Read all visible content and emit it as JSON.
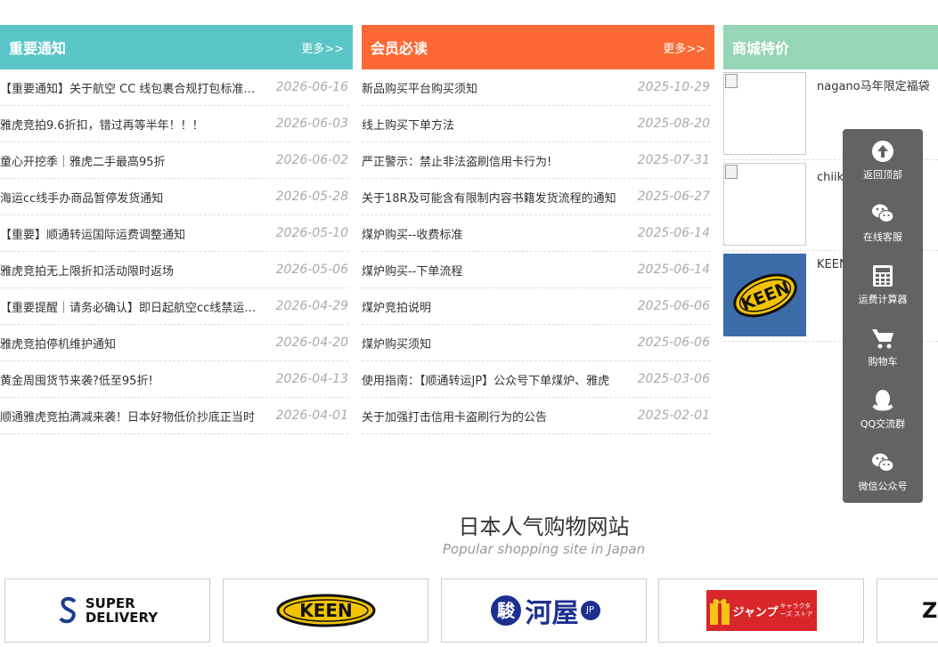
{
  "notice": {
    "title": "重要通知",
    "more": "更多>>",
    "items": [
      {
        "text": "【重要通知】关于航空 CC 线包裹合规打包标准通知",
        "date": "2026-06-16"
      },
      {
        "text": "雅虎竞拍9.6折扣，错过再等半年！！！",
        "date": "2026-06-03"
      },
      {
        "text": "童心开挖季｜雅虎二手最高95折",
        "date": "2026-06-02"
      },
      {
        "text": "海运cc线手办商品暂停发货通知",
        "date": "2026-05-28"
      },
      {
        "text": "【重要】顺通转运国际运费调整通知",
        "date": "2026-05-10"
      },
      {
        "text": "雅虎竞拍无上限折扣活动限时返场",
        "date": "2026-05-06"
      },
      {
        "text": "【重要提醒｜请务必确认】即日起航空cc线禁运商品通知",
        "date": "2026-04-29"
      },
      {
        "text": "雅虎竞拍停机维护通知",
        "date": "2026-04-20"
      },
      {
        "text": "黄金周囤货节来袭?低至95折!",
        "date": "2026-04-13"
      },
      {
        "text": "顺通雅虎竞拍满减来袭！日本好物低价抄底正当时",
        "date": "2026-04-01"
      }
    ]
  },
  "member": {
    "title": "会员必读",
    "more": "更多>>",
    "items": [
      {
        "text": "新品购买平台购买须知",
        "date": "2025-10-29"
      },
      {
        "text": "线上购买下单方法",
        "date": "2025-08-20"
      },
      {
        "text": "严正警示：禁止非法盗刷信用卡行为!",
        "date": "2025-07-31"
      },
      {
        "text": "关于18R及可能含有限制内容书籍发货流程的通知",
        "date": "2025-06-27"
      },
      {
        "text": "煤炉购买--收费标准",
        "date": "2025-06-14"
      },
      {
        "text": "煤炉购买--下单流程",
        "date": "2025-06-14"
      },
      {
        "text": "煤炉竞拍说明",
        "date": "2025-06-06"
      },
      {
        "text": "煤炉购买须知",
        "date": "2025-06-06"
      },
      {
        "text": "使用指南：【顺通转运JP】公众号下单煤炉、雅虎",
        "date": "2025-03-06"
      },
      {
        "text": "关于加强打击信用卡盗刷行为的公告",
        "date": "2025-02-01"
      }
    ]
  },
  "special": {
    "title": "商城特价",
    "items": [
      {
        "name": "nagano马年限定福袋",
        "image": "broken"
      },
      {
        "name": "chiikawa福袋",
        "image": "broken"
      },
      {
        "name": "KEEN",
        "image": "keen-logo"
      }
    ]
  },
  "sidebar": {
    "items": [
      {
        "label": "返回顶部",
        "icon": "arrow-up-circle-icon"
      },
      {
        "label": "在线客服",
        "icon": "wechat-icon"
      },
      {
        "label": "运费计算器",
        "icon": "calculator-icon"
      },
      {
        "label": "购物车",
        "icon": "cart-icon"
      },
      {
        "label": "QQ交流群",
        "icon": "qq-icon"
      },
      {
        "label": "微信公众号",
        "icon": "wechat-icon"
      }
    ]
  },
  "shopping": {
    "title": "日本人气购物网站",
    "subtitle": "Popular shopping site in Japan",
    "logos": [
      {
        "brand": "SUPER DELIVERY",
        "line1": "SUPER",
        "line2": "DELIVERY"
      },
      {
        "brand": "KEEN",
        "text": "KEEN"
      },
      {
        "brand": "駿河屋",
        "text": "河屋",
        "jp": "JP"
      },
      {
        "brand": "ジャンプキャラクターズストア",
        "text": "ジャンプ",
        "sub": "キャラクターズ ストア"
      },
      {
        "brand": "ZO",
        "text": "ZO"
      }
    ]
  },
  "colors": {
    "notice": "#5ac6c8",
    "member": "#fc6934",
    "special": "#96d5b5",
    "sidebar": "#636363"
  }
}
